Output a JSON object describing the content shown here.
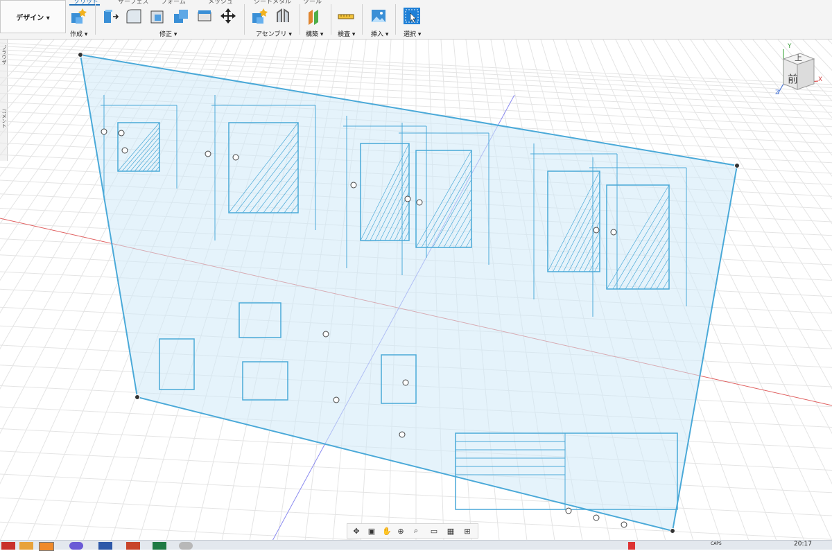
{
  "workspace": {
    "label": "デザイン ▾"
  },
  "tabs": [
    {
      "label": "ソリッド",
      "active": true
    },
    {
      "label": "サーフェス",
      "active": false
    },
    {
      "label": "フォーム",
      "active": false
    },
    {
      "label": "メッシュ",
      "active": false
    },
    {
      "label": "シートメタル",
      "active": false
    },
    {
      "label": "ツール",
      "active": false
    }
  ],
  "groups": {
    "create": "作成 ▾",
    "modify": "修正 ▾",
    "assemble": "アセンブリ ▾",
    "construct": "構築 ▾",
    "inspect": "検査 ▾",
    "insert": "挿入 ▾",
    "select": "選択 ▾"
  },
  "side_panel": {
    "label_top": "ブラウザ",
    "label_bottom": "コメント"
  },
  "viewcube": {
    "top_face": "上",
    "front_face": "前",
    "axis_x": "X",
    "axis_y": "Y",
    "axis_z": "Z"
  },
  "taskbar": {
    "clock": "20:17",
    "tray_text": "CAPS"
  },
  "colors": {
    "accent": "#1e6fb8",
    "canvas_fill": "#cfeaf7",
    "sketch_line": "#4aa9d8",
    "axis_red": "#e06060",
    "axis_blue": "#8a8af0"
  }
}
